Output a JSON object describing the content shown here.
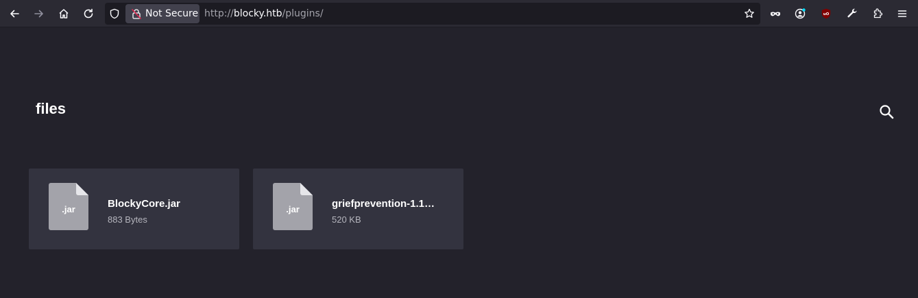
{
  "browser": {
    "security_label": "Not Secure",
    "url": {
      "scheme": "http://",
      "host": "blocky.htb",
      "path": "/plugins/"
    },
    "toolbar_icons": [
      "back-icon",
      "forward-icon",
      "home-icon",
      "reload-icon",
      "shield-icon",
      "insecure-lock-icon",
      "bookmark-star-icon",
      "private-mask-icon",
      "account-icon",
      "ublock-icon",
      "wrench-icon",
      "extensions-icon",
      "menu-icon"
    ],
    "accent_colors": {
      "insecure": "#e22850",
      "ublock": "#800000",
      "account_dot": "#00ddff"
    }
  },
  "page": {
    "title": "files",
    "search_icon": "search-icon",
    "files": [
      {
        "ext": ".jar",
        "name": "BlockyCore.jar",
        "size": "883 Bytes"
      },
      {
        "ext": ".jar",
        "name": "griefprevention-1.1…",
        "size": "520 KB"
      }
    ]
  }
}
